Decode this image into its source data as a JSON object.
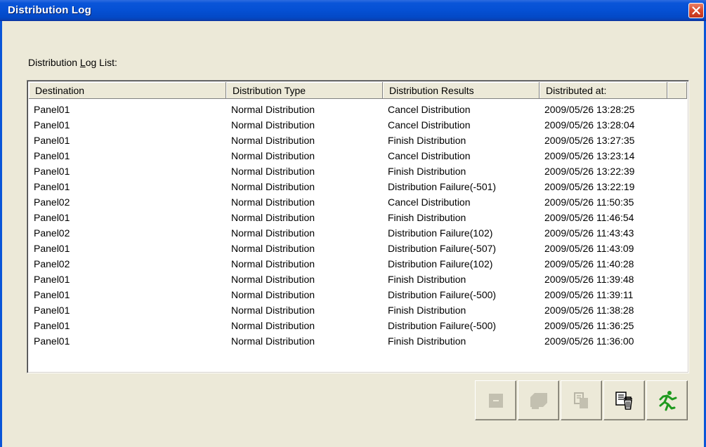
{
  "window": {
    "title": "Distribution Log"
  },
  "list": {
    "label_prefix": "Distribution ",
    "label_mnemonic": "L",
    "label_suffix": "og List:",
    "columns": [
      "Destination",
      "Distribution Type",
      "Distribution Results",
      "Distributed at:"
    ],
    "rows": [
      [
        "Panel01",
        "Normal Distribution",
        "Cancel Distribution",
        "2009/05/26 13:28:25"
      ],
      [
        "Panel01",
        "Normal Distribution",
        "Cancel Distribution",
        "2009/05/26 13:28:04"
      ],
      [
        "Panel01",
        "Normal Distribution",
        "Finish Distribution",
        "2009/05/26 13:27:35"
      ],
      [
        "Panel01",
        "Normal Distribution",
        "Cancel Distribution",
        "2009/05/26 13:23:14"
      ],
      [
        "Panel01",
        "Normal Distribution",
        "Finish Distribution",
        "2009/05/26 13:22:39"
      ],
      [
        "Panel01",
        "Normal Distribution",
        "Distribution Failure(-501)",
        "2009/05/26 13:22:19"
      ],
      [
        "Panel02",
        "Normal Distribution",
        "Cancel Distribution",
        "2009/05/26 11:50:35"
      ],
      [
        "Panel01",
        "Normal Distribution",
        "Finish Distribution",
        "2009/05/26 11:46:54"
      ],
      [
        "Panel02",
        "Normal Distribution",
        "Distribution Failure(102)",
        "2009/05/26 11:43:43"
      ],
      [
        "Panel01",
        "Normal Distribution",
        "Distribution Failure(-507)",
        "2009/05/26 11:43:09"
      ],
      [
        "Panel02",
        "Normal Distribution",
        "Distribution Failure(102)",
        "2009/05/26 11:40:28"
      ],
      [
        "Panel01",
        "Normal Distribution",
        "Finish Distribution",
        "2009/05/26 11:39:48"
      ],
      [
        "Panel01",
        "Normal Distribution",
        "Distribution Failure(-500)",
        "2009/05/26 11:39:11"
      ],
      [
        "Panel01",
        "Normal Distribution",
        "Finish Distribution",
        "2009/05/26 11:38:28"
      ],
      [
        "Panel01",
        "Normal Distribution",
        "Distribution Failure(-500)",
        "2009/05/26 11:36:25"
      ],
      [
        "Panel01",
        "Normal Distribution",
        "Finish Distribution",
        "2009/05/26 11:36:00"
      ]
    ]
  },
  "toolbar": {
    "buttons": [
      {
        "icon": "minus-icon",
        "enabled": false
      },
      {
        "icon": "monitor-icon",
        "enabled": false
      },
      {
        "icon": "copy-document-icon",
        "enabled": false
      },
      {
        "icon": "delete-log-icon",
        "enabled": true
      },
      {
        "icon": "exit-running-man-icon",
        "enabled": true
      }
    ]
  },
  "colors": {
    "title_bar": "#0550d4",
    "close_button": "#d8492c",
    "dialog_background": "#ece9d8",
    "exit_icon": "#1f9a1f",
    "disabled_icon": "#b8b5a6"
  }
}
